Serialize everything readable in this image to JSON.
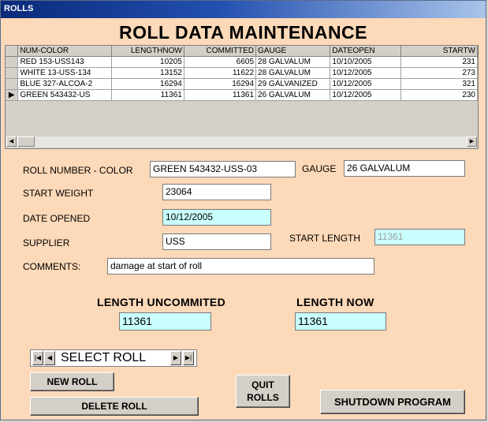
{
  "window": {
    "title": "ROLLS"
  },
  "heading": "ROLL DATA MAINTENANCE",
  "grid": {
    "columns": [
      "NUM-COLOR",
      "LENGTHNOW",
      "COMMITTED",
      "GAUGE",
      "DATEOPEN",
      "STARTW"
    ],
    "rows": [
      [
        "RED  153-USS143",
        "10205",
        "6605",
        "28 GALVALUM",
        "10/10/2005",
        "231"
      ],
      [
        "WHITE 13-USS-134",
        "13152",
        "11622",
        "28 GALVALUM",
        "10/12/2005",
        "273"
      ],
      [
        "BLUE  327-ALCOA-2",
        "16294",
        "16294",
        "29 GALVANIZED",
        "10/12/2005",
        "321"
      ],
      [
        "GREEN  543432-US",
        "11361",
        "11361",
        "26 GALVALUM",
        "10/12/2005",
        "230"
      ]
    ],
    "current_row_marker": "▶",
    "scroll_left": "◀",
    "scroll_right": "▶"
  },
  "form": {
    "roll_number_label": "ROLL NUMBER - COLOR",
    "roll_number_value": "GREEN  543432-USS-03",
    "gauge_label": "GAUGE",
    "gauge_value": "26 GALVALUM",
    "start_weight_label": "START WEIGHT",
    "start_weight_value": "23064",
    "date_opened_label": "DATE OPENED",
    "date_opened_value": "10/12/2005",
    "supplier_label": "SUPPLIER",
    "supplier_value": "USS",
    "start_length_label": "START LENGTH",
    "start_length_value": "11361",
    "comments_label": "COMMENTS:",
    "comments_value": "damage at start of roll"
  },
  "lengths": {
    "uncommitted_label": "LENGTH UNCOMMITED",
    "uncommitted_value": "11361",
    "now_label": "LENGTH NOW",
    "now_value": "11361"
  },
  "navigator": {
    "first": "|◀",
    "prev": "◀",
    "label": "SELECT ROLL",
    "next": "▶",
    "last": "▶|"
  },
  "buttons": {
    "new_roll": "NEW ROLL",
    "delete_roll": "DELETE ROLL",
    "quit_line1": "QUIT",
    "quit_line2": "ROLLS",
    "shutdown": "SHUTDOWN PROGRAM"
  },
  "colors": {
    "form_background": "#fcd9b8",
    "highlight_field": "#c9ffff",
    "title_bar": "#0a2a7a"
  }
}
